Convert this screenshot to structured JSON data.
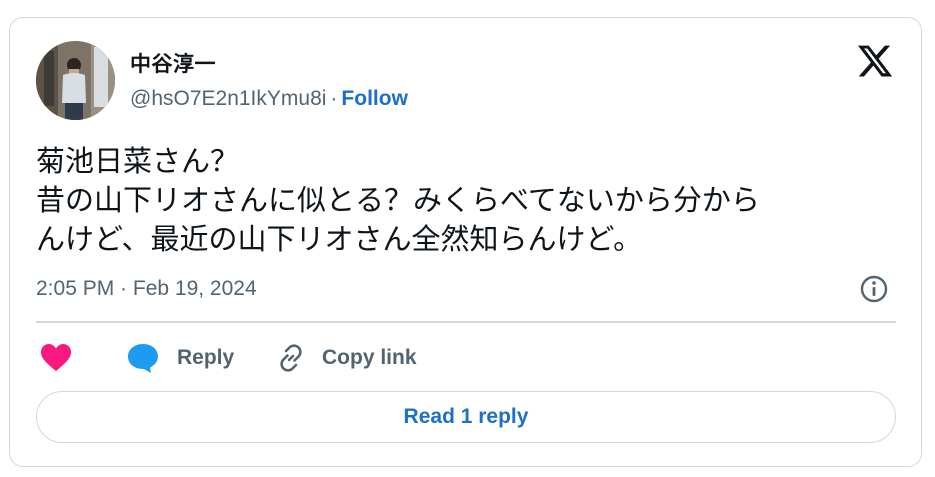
{
  "author": {
    "display_name": "中谷淳一",
    "handle": "@hsO7E2n1IkYmu8i",
    "separator": "·",
    "follow_label": "Follow"
  },
  "tweet": {
    "lines": [
      "菊池日菜さん？",
      "昔の山下リオさんに似とる？みくらべてないから分から",
      "んけど、最近の山下リオさん全然知らんけど。"
    ],
    "timestamp": "2:05 PM · Feb 19, 2024"
  },
  "actions": {
    "like_icon": "heart-icon",
    "reply_label": "Reply",
    "copy_link_label": "Copy link"
  },
  "read_replies_label": "Read 1 reply",
  "colors": {
    "text": "#0f1419",
    "secondary": "#536471",
    "accent_blue": "#1d6fcf",
    "like_pink": "#f91880",
    "border": "#cfd9de"
  }
}
